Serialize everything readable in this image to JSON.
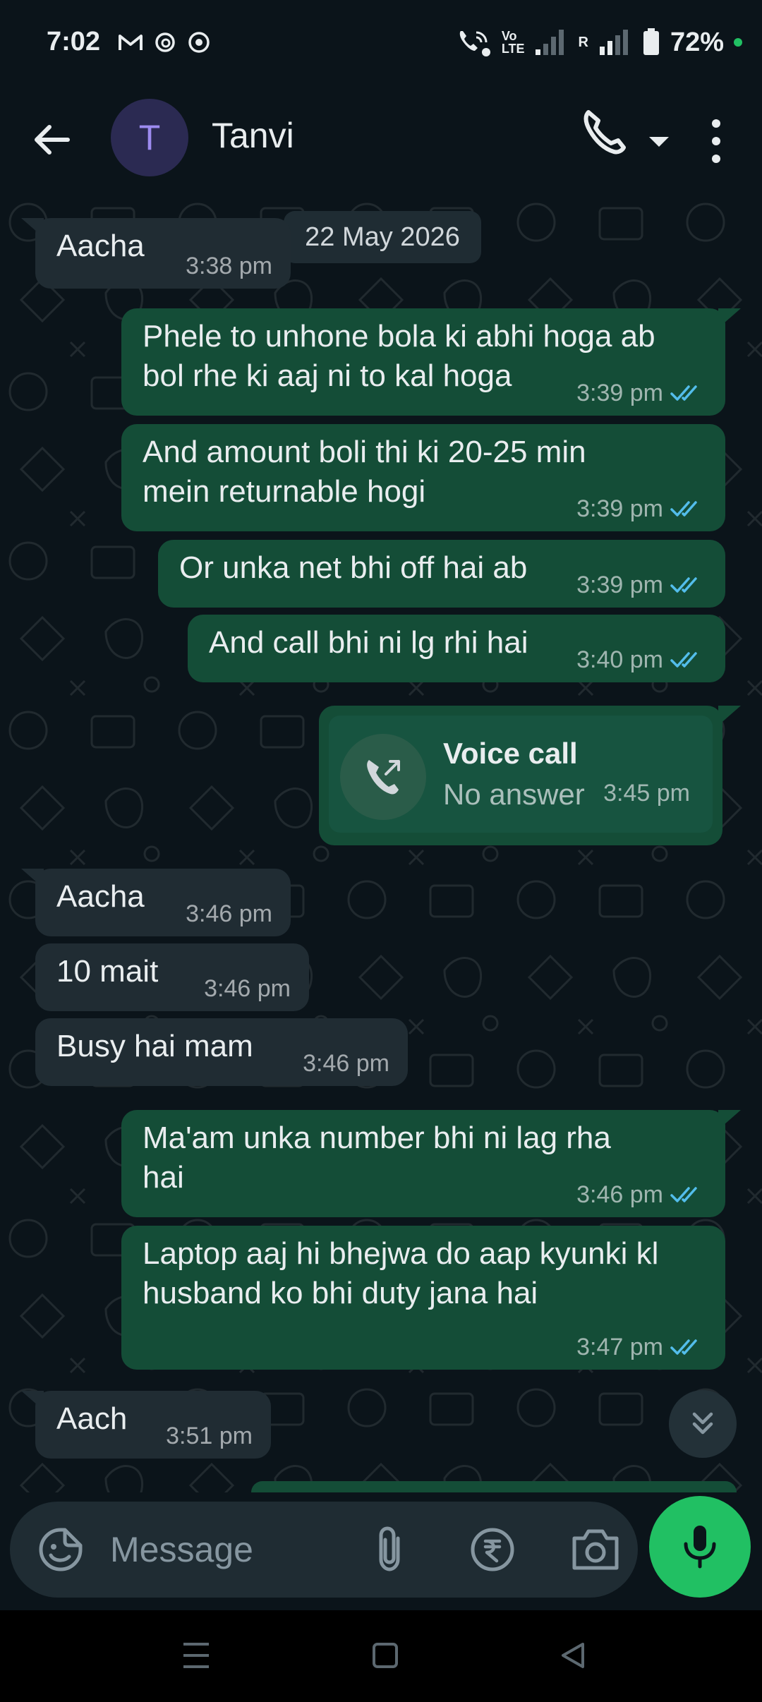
{
  "status_bar": {
    "time": "7:02",
    "battery": "72%",
    "network_label_top": "Vo",
    "network_label_bottom": "LTE",
    "roaming": "R"
  },
  "header": {
    "avatar_initial": "T",
    "contact_name": "Tanvi",
    "icons": [
      "back-arrow-icon",
      "phone-icon",
      "dropdown-icon",
      "more-vert-icon"
    ]
  },
  "chat": {
    "date_chip": "22 May 2026",
    "messages": [
      {
        "dir": "in",
        "lines": [
          "Aacha"
        ],
        "time": "3:38 pm"
      },
      {
        "dir": "out",
        "lines": [
          "Phele to unhone bola ki abhi hoga ab",
          "bol rhe ki aaj ni to kal hoga"
        ],
        "time": "3:39 pm",
        "read": true
      },
      {
        "dir": "out",
        "lines": [
          "And amount boli thi ki 20-25 min",
          "mein returnable hogi"
        ],
        "time": "3:39 pm",
        "read": true
      },
      {
        "dir": "out",
        "lines": [
          "Or unka net bhi off hai ab"
        ],
        "time": "3:39 pm",
        "read": true
      },
      {
        "dir": "out",
        "lines": [
          "And call bhi ni lg rhi hai"
        ],
        "time": "3:40 pm",
        "read": true
      },
      {
        "dir": "in",
        "lines": [
          "Aacha"
        ],
        "time": "3:46 pm"
      },
      {
        "dir": "in",
        "lines": [
          "10 mait"
        ],
        "time": "3:46 pm"
      },
      {
        "dir": "in",
        "lines": [
          "Busy hai mam"
        ],
        "time": "3:46 pm"
      },
      {
        "dir": "out",
        "lines": [
          "Ma'am unka number bhi ni lag rha",
          "hai"
        ],
        "time": "3:46 pm",
        "read": true
      },
      {
        "dir": "out",
        "lines": [
          "Laptop aaj hi bhejwa do aap kyunki kl",
          "husband ko bhi duty jana hai"
        ],
        "time": "3:47 pm",
        "read": true
      },
      {
        "dir": "in",
        "lines": [
          "Aach"
        ],
        "time": "3:51 pm"
      }
    ],
    "voice_call": {
      "title": "Voice call",
      "status": "No answer",
      "time": "3:45 pm"
    },
    "tick_color": "#53bdeb"
  },
  "input_bar": {
    "placeholder": "Message",
    "icons": [
      "emoji-icon",
      "attach-icon",
      "rupee-icon",
      "camera-icon",
      "mic-icon"
    ]
  },
  "colors": {
    "background": "#0b141a",
    "incoming_bubble": "#202c33",
    "outgoing_bubble": "#144d37",
    "accent": "#21c063",
    "avatar_bg": "#2b2a52",
    "avatar_fg": "#9d8bf0"
  }
}
